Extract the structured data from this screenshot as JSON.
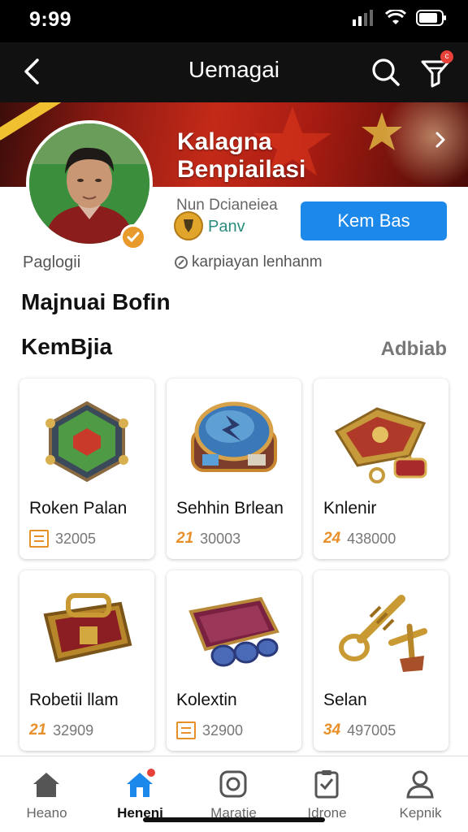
{
  "status_bar": {
    "time": "9:99"
  },
  "header": {
    "title": "Uemagai",
    "notification_count": "c"
  },
  "profile": {
    "banner_title_line1": "Kalagna",
    "banner_title_line2": "Benpiailasi",
    "subtitle": "Nun Dcianeiea",
    "rank_label": "Panv",
    "follow_label": "Kem Bas",
    "name": "Paglogii",
    "meta_text": "karpiayan lenhanm"
  },
  "section": {
    "title": "Majnuai Bofin",
    "subsection_title": "KemBjia",
    "see_all_label": "Adbiab"
  },
  "items": [
    {
      "name": "Roken Palan",
      "price_icon": "box",
      "price": "32005"
    },
    {
      "name": "Sehhin Brlean",
      "price_icon": "21",
      "price": "30003"
    },
    {
      "name": "Knlenir",
      "price_icon": "24",
      "price": "438000"
    },
    {
      "name": "Robetii llam",
      "price_icon": "21",
      "price": "32909"
    },
    {
      "name": "Kolextin",
      "price_icon": "box",
      "price": "32900"
    },
    {
      "name": "Selan",
      "price_icon": "34",
      "price": "497005"
    }
  ],
  "tabs": [
    {
      "label": "Heano",
      "icon": "home-icon"
    },
    {
      "label": "Heneni",
      "icon": "home-icon",
      "active": true
    },
    {
      "label": "Maratie",
      "icon": "instagram-icon"
    },
    {
      "label": "Idrone",
      "icon": "clipboard-icon"
    },
    {
      "label": "Kepnik",
      "icon": "profile-icon"
    }
  ],
  "colors": {
    "accent": "#1c88ea",
    "price_accent": "#e7902a",
    "banner_red": "#c42a18",
    "header_bg": "#111111"
  }
}
